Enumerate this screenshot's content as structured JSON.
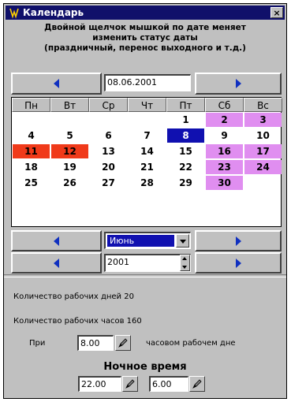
{
  "window": {
    "title": "Календарь",
    "close_glyph": "×"
  },
  "hint": {
    "line1": "Двойной щелчок мышкой по дате меняет",
    "line2": "изменить статус даты",
    "line3": "(праздничный, перенос выходного и т.д.)"
  },
  "date_nav": {
    "value": "08.06.2001"
  },
  "calendar": {
    "weekdays": [
      "Пн",
      "Вт",
      "Ср",
      "Чт",
      "Пт",
      "Сб",
      "Вс"
    ],
    "rows": [
      [
        "",
        "",
        "",
        "",
        "1",
        "2",
        "3"
      ],
      [
        "4",
        "5",
        "6",
        "7",
        "8",
        "9",
        "10"
      ],
      [
        "11",
        "12",
        "13",
        "14",
        "15",
        "16",
        "17"
      ],
      [
        "18",
        "19",
        "20",
        "21",
        "22",
        "23",
        "24"
      ],
      [
        "25",
        "26",
        "27",
        "28",
        "29",
        "30",
        ""
      ]
    ],
    "styles": [
      [
        "",
        "",
        "",
        "",
        "",
        "weekend",
        "weekend"
      ],
      [
        "",
        "",
        "",
        "",
        "selected",
        "",
        ""
      ],
      [
        "holiday",
        "holiday",
        "",
        "",
        "",
        "weekend",
        "weekend"
      ],
      [
        "",
        "",
        "",
        "",
        "",
        "weekend",
        "weekend"
      ],
      [
        "",
        "",
        "",
        "",
        "",
        "weekend",
        ""
      ]
    ],
    "colors": {
      "weekend": "#e08ef0",
      "holiday": "#f03a1a",
      "selected": "#1010b0"
    }
  },
  "month_select": {
    "value": "Июнь"
  },
  "year_spin": {
    "value": "2001"
  },
  "stats": {
    "work_days": "Количество рабочих дней 20",
    "work_hours": "Количество рабочих часов 160"
  },
  "workday": {
    "prefix": "При",
    "hours": "8.00",
    "suffix": "часовом рабочем дне"
  },
  "night": {
    "title": "Ночное время",
    "start": "22.00",
    "end": "6.00"
  },
  "icons": {
    "app": "calendar-app-icon",
    "close": "close-icon",
    "prev": "arrow-left-icon",
    "next": "arrow-right-icon",
    "dropdown": "chevron-down-icon",
    "spin": "spin-updown-icon",
    "edit": "edit-pencil-icon"
  }
}
